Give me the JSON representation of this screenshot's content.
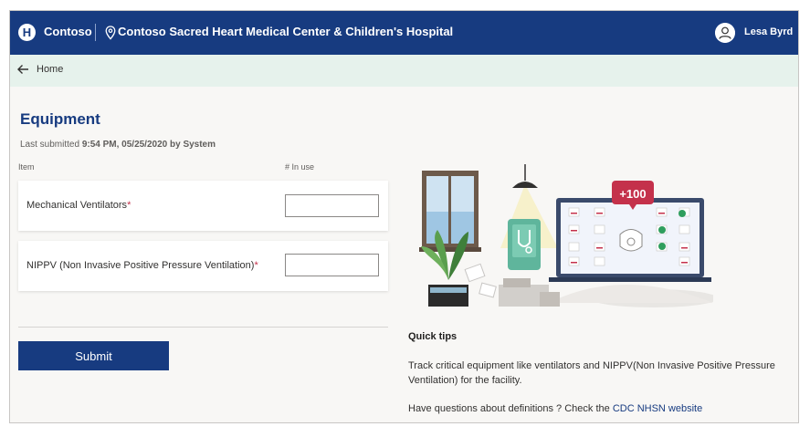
{
  "header": {
    "brand_name": "Contoso",
    "facility_name": "Contoso Sacred Heart Medical Center & Children's Hospital",
    "user_name": "Lesa Byrd",
    "brand_color": "#173b80"
  },
  "nav": {
    "home_label": "Home"
  },
  "page": {
    "title": "Equipment",
    "last_submitted_prefix": "Last submitted ",
    "last_submitted_value": "9:54 PM, 05/25/2020 by System"
  },
  "table": {
    "col_item": "Item",
    "col_in_use": "# In use",
    "rows": [
      {
        "label": "Mechanical Ventilators",
        "required_mark": "*",
        "value": ""
      },
      {
        "label": "NIPPV (Non Invasive Positive Pressure Ventilation)",
        "required_mark": "*",
        "value": ""
      }
    ]
  },
  "form": {
    "submit_label": "Submit"
  },
  "illustration": {
    "badge_text": "+100"
  },
  "tips": {
    "title": "Quick tips",
    "body": "Track critical equipment like ventilators and NIPPV(Non Invasive Positive Pressure Ventilation) for the facility.",
    "question": "Have questions about definitions ? Check the ",
    "link_text": "CDC NHSN website"
  }
}
